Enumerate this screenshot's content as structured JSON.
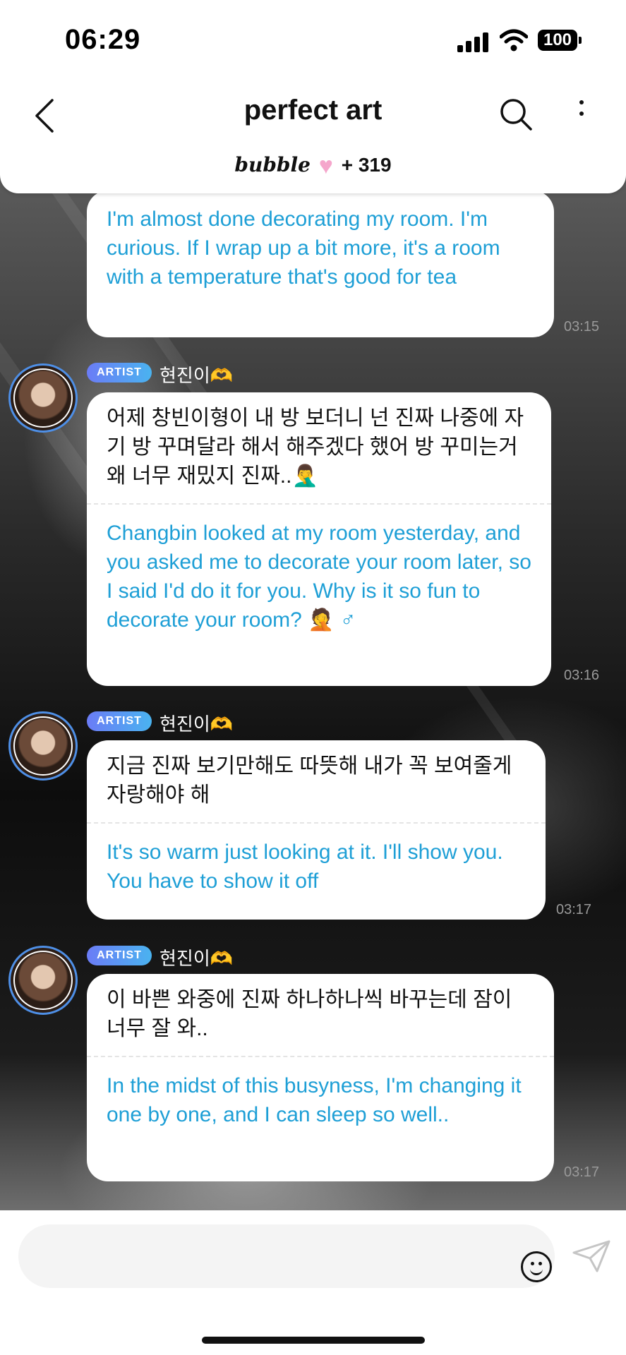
{
  "status_bar": {
    "time": "06:29",
    "battery": "100"
  },
  "header": {
    "title": "perfect art",
    "brand": "bubble",
    "member_count": "+ 319"
  },
  "messages": [
    {
      "en": "I'm almost done decorating my room. I'm curious. If I wrap up a bit more, it's a room with a temperature that's good for tea",
      "time": "03:15"
    },
    {
      "tag": "ARTIST",
      "sender": "현진이🫶",
      "ko": "어제 창빈이형이 내 방 보더니 넌 진짜 나중에 자기 방 꾸며달라 해서 해주겠다 했어 방 꾸미는거 왜 너무 재밌지 진짜..🤦‍♂️",
      "en": "Changbin looked at my room yesterday, and you asked me to decorate your room later, so I said I'd do it for you. Why is it so fun to decorate your room? 🤦 ♂",
      "time": "03:16"
    },
    {
      "tag": "ARTIST",
      "sender": "현진이🫶",
      "ko": "지금 진짜 보기만해도 따뜻해 내가 꼭 보여줄게 자랑해야 해",
      "en": "It's so warm just looking at it. I'll show you. You have to show it off",
      "time": "03:17"
    },
    {
      "tag": "ARTIST",
      "sender": "현진이🫶",
      "ko": "이 바쁜 와중에 진짜 하나하나씩 바꾸는데 잠이 너무 잘 와..",
      "en": "In the midst of this busyness, I'm changing it one by one, and I can sleep so well..",
      "time": "03:17"
    }
  ],
  "composer": {
    "placeholder": ""
  },
  "icons": {
    "back": "chevron-left-icon",
    "search": "search-icon",
    "more": "more-vertical-icon",
    "emoji": "smile-icon",
    "send": "send-icon",
    "heart": "heart-icon"
  },
  "colors": {
    "translation_text": "#1e9fd6",
    "artist_tag_start": "#6b7cf6",
    "artist_tag_end": "#4ab3f0",
    "avatar_ring": "#4e8fe6"
  }
}
